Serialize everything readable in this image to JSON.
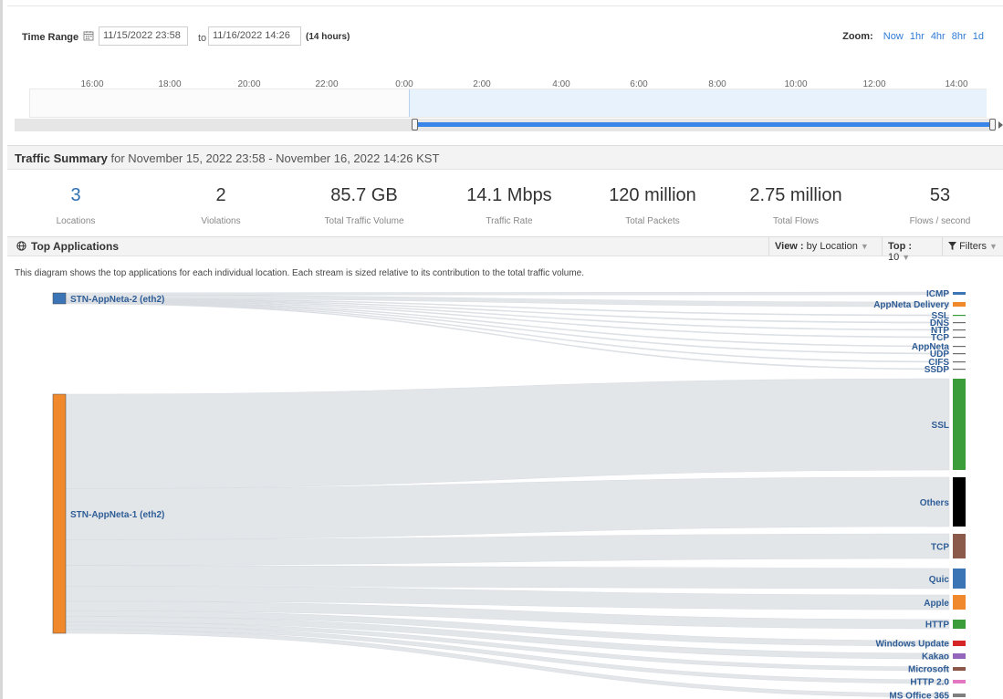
{
  "time_range": {
    "label": "Time Range",
    "start": "11/15/2022 23:58",
    "to": "to",
    "end": "11/16/2022 14:26",
    "duration": "(14 hours)",
    "zoom_label": "Zoom:",
    "zoom_options": [
      "Now",
      "1hr",
      "4hr",
      "8hr",
      "1d"
    ],
    "timeline_ticks": [
      "16:00",
      "18:00",
      "20:00",
      "22:00",
      "0:00",
      "2:00",
      "4:00",
      "6:00",
      "8:00",
      "10:00",
      "12:00",
      "14:00"
    ],
    "selection_start_fraction": 0.395,
    "selection_end_fraction": 1.0
  },
  "traffic_summary": {
    "title": "Traffic Summary",
    "subtitle": "for November 15, 2022 23:58 - November 16, 2022 14:26 KST",
    "metrics": [
      {
        "value": "3",
        "label": "Locations"
      },
      {
        "value": "2",
        "label": "Violations"
      },
      {
        "value": "85.7 GB",
        "label": "Total Traffic Volume"
      },
      {
        "value": "14.1 Mbps",
        "label": "Traffic Rate"
      },
      {
        "value": "120 million",
        "label": "Total Packets"
      },
      {
        "value": "2.75 million",
        "label": "Total Flows"
      },
      {
        "value": "53",
        "label": "Flows / second"
      }
    ]
  },
  "top_applications": {
    "title": "Top Applications",
    "view_key": "View :",
    "view_value": "by Location",
    "top_key": "Top :",
    "top_value": "10",
    "filters": "Filters",
    "description": "This diagram shows the top applications for each individual location. Each stream is sized relative to its contribution to the total traffic volume."
  },
  "sankey": {
    "sources": [
      {
        "name": "STN-AppNeta-2 (eth2)",
        "color": "#3b75b5"
      },
      {
        "name": "STN-AppNeta-1 (eth2)",
        "color": "#f0892b"
      }
    ],
    "targets": [
      {
        "name": "ICMP",
        "color": "#3b75b5",
        "source": 0
      },
      {
        "name": "AppNeta Delivery",
        "color": "#f0892b",
        "source": 0
      },
      {
        "name": "SSL",
        "color": "#3a9d3a",
        "source": 0
      },
      {
        "name": "DNS",
        "color": "#6e6e6e",
        "source": 0
      },
      {
        "name": "NTP",
        "color": "#6e6e6e",
        "source": 0
      },
      {
        "name": "TCP",
        "color": "#6e6e6e",
        "source": 0
      },
      {
        "name": "AppNeta",
        "color": "#6e6e6e",
        "source": 0
      },
      {
        "name": "UDP",
        "color": "#6e6e6e",
        "source": 0
      },
      {
        "name": "CIFS",
        "color": "#6e6e6e",
        "source": 0
      },
      {
        "name": "SSDP",
        "color": "#6e6e6e",
        "source": 0
      },
      {
        "name": "SSL",
        "color": "#3a9d3a",
        "source": 1
      },
      {
        "name": "Others",
        "color": "#000000",
        "source": 1
      },
      {
        "name": "TCP",
        "color": "#8c5a4a",
        "source": 1
      },
      {
        "name": "Quic",
        "color": "#3b75b5",
        "source": 1
      },
      {
        "name": "Apple",
        "color": "#f0892b",
        "source": 1
      },
      {
        "name": "HTTP",
        "color": "#3a9d3a",
        "source": 1
      },
      {
        "name": "Windows Update",
        "color": "#d62728",
        "source": 1
      },
      {
        "name": "Kakao",
        "color": "#9467bd",
        "source": 1
      },
      {
        "name": "Microsoft",
        "color": "#8c564b",
        "source": 1
      },
      {
        "name": "HTTP 2.0",
        "color": "#e377c2",
        "source": 1
      },
      {
        "name": "MS Office 365",
        "color": "#7f7f7f",
        "source": 1
      }
    ]
  }
}
